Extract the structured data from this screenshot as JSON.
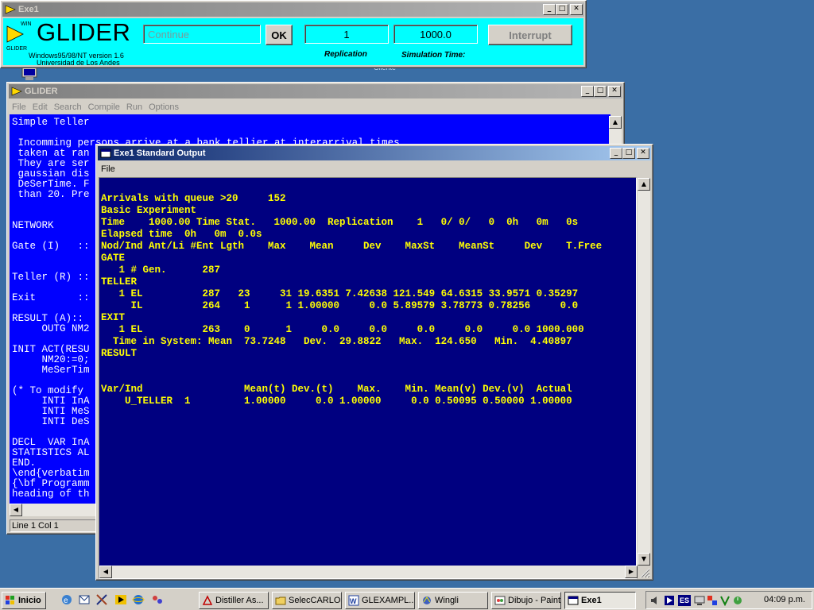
{
  "exe1_window": {
    "title": "Exe1",
    "app_name": "GLIDER",
    "logo_text_top": "WIN",
    "logo_text_bottom": "GLIDER",
    "version_line1": "Windows95/98/NT version 1.6",
    "version_line2": "Universidad de Los Andes",
    "continue_placeholder": "Continue",
    "ok_label": "OK",
    "replication_value": "1",
    "simulation_time_value": "1000.0",
    "interrupt_label": "Interrupt",
    "replication_label": "Replication",
    "simulation_time_label": "Simulation Time:"
  },
  "desktop": {
    "partial_icon_label": "Cliente"
  },
  "glider_window": {
    "title": "GLIDER",
    "menu": [
      "File",
      "Edit",
      "Search",
      "Compile",
      "Run",
      "Options"
    ],
    "code_lines": [
      "Simple Teller",
      "",
      " Incomming persons arrive at a bank tellier at interarrival times",
      " taken at ran",
      " They are ser",
      " gaussian dis",
      " DeSerTime. F",
      " than 20. Pre",
      "",
      "",
      "NETWORK",
      "",
      "Gate (I)   ::",
      "",
      "",
      "Teller (R) ::",
      "",
      "Exit       ::",
      "",
      "RESULT (A)::",
      "     OUTG NM2",
      "",
      "INIT ACT(RESU",
      "     NM20:=0;",
      "     MeSerTim",
      "",
      "(* To modify ",
      "     INTI InA",
      "     INTI MeS",
      "     INTI DeS",
      "",
      "DECL  VAR InA",
      "STATISTICS AL",
      "END.",
      "\\end{verbatim",
      "{\\bf Programm",
      "heading of th"
    ],
    "status": "Line 1 Col 1"
  },
  "stdout_window": {
    "title": "Exe1 Standard Output",
    "menu": [
      "File"
    ],
    "lines": [
      "Arrivals with queue >20     152",
      "Basic Experiment",
      "Time    1000.00 Time Stat.   1000.00  Replication    1   0/ 0/   0  0h   0m   0s",
      "Elapsed time  0h   0m  0.0s",
      "Nod/Ind Ant/Li #Ent Lgth    Max    Mean     Dev    MaxSt    MeanSt     Dev    T.Free",
      "GATE",
      "   1 # Gen.      287",
      "TELLER",
      "   1 EL          287   23     31 19.6351 7.42638 121.549 64.6315 33.9571 0.35297",
      "     IL          264    1      1 1.00000     0.0 5.89579 3.78773 0.78256     0.0",
      "EXIT",
      "   1 EL          263    0      1     0.0     0.0     0.0     0.0     0.0 1000.000",
      "  Time in System: Mean  73.7248   Dev.  29.8822   Max.  124.650   Min.  4.40897",
      "RESULT",
      "",
      "",
      "Var/Ind                 Mean(t) Dev.(t)    Max.    Min. Mean(v) Dev.(v)  Actual",
      "    U_TELLER  1         1.00000     0.0 1.00000     0.0 0.50095 0.50000 1.00000"
    ]
  },
  "taskbar": {
    "start_label": "Inicio",
    "tasks": [
      "Distiller As...",
      "SelecCARLOS",
      "GLEXAMPL...",
      "Wingli",
      "Dibujo - Paint",
      "Exe1"
    ],
    "language": "ES",
    "clock": "04:09 p.m."
  },
  "colors": {
    "desktop": "#3a6ea5",
    "exe1_background": "#00ffff",
    "editor_background": "#0000ff",
    "output_background": "#000080",
    "output_text": "#ffff00",
    "active_title": "#0a246a",
    "inactive_title": "#808080"
  }
}
